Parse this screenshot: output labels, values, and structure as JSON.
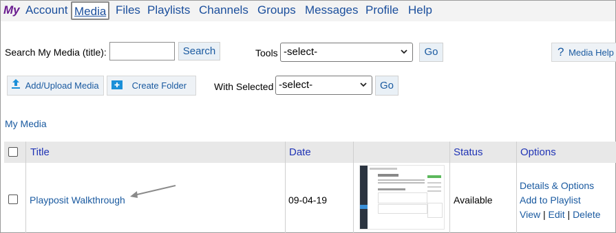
{
  "nav": {
    "my": "My",
    "items": [
      "Account",
      "Media",
      "Files",
      "Playlists",
      "Channels",
      "Groups",
      "Messages",
      "Profile",
      "Help"
    ],
    "active": "Media"
  },
  "search": {
    "label": "Search My Media (title):",
    "value": "",
    "button": "Search"
  },
  "tools": {
    "label": "Tools",
    "selected": "-select-",
    "go": "Go"
  },
  "help": {
    "icon_text": "?",
    "label": "Media Help"
  },
  "toolbar": {
    "add_upload": "Add/Upload Media",
    "create_folder": "Create Folder",
    "with_selected_label": "With Selected",
    "with_selected_value": "-select-",
    "go": "Go"
  },
  "section_title": "My Media",
  "table": {
    "columns": [
      "Title",
      "Date",
      "",
      "Status",
      "Options"
    ],
    "rows": [
      {
        "title": "Playposit Walkthrough",
        "date": "09-04-19",
        "status": "Available",
        "options": {
          "details": "Details & Options",
          "add_playlist": "Add to Playlist",
          "view": "View",
          "sep1": "|",
          "edit": "Edit",
          "sep2": "|",
          "delete": "Delete"
        }
      }
    ]
  },
  "colors": {
    "link": "#1a5aa0",
    "header_link": "#1f33b5",
    "my_brand": "#6a1b8f",
    "header_bg": "#e8e8e8",
    "nav_bg": "#f3f3f3"
  }
}
